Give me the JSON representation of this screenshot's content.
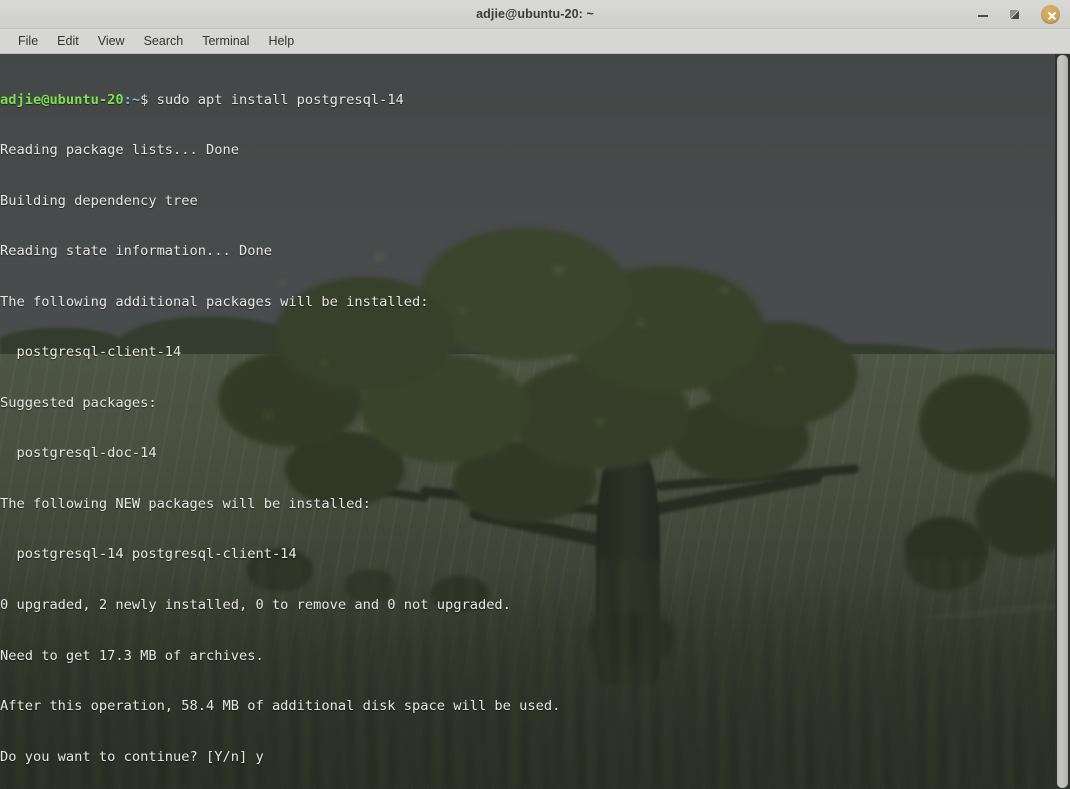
{
  "window": {
    "title": "adjie@ubuntu-20: ~",
    "controls": {
      "minimize_label": "minimize",
      "maximize_label": "restore",
      "close_label": "close",
      "close_color": "#c9a45c"
    }
  },
  "menubar": {
    "items": [
      {
        "label": "File"
      },
      {
        "label": "Edit"
      },
      {
        "label": "View"
      },
      {
        "label": "Search"
      },
      {
        "label": "Terminal"
      },
      {
        "label": "Help"
      }
    ]
  },
  "terminal": {
    "colors": {
      "prompt_user": "#7ee04f",
      "prompt_path": "#6ec5d8",
      "text": "#e8e8e3",
      "background": "#3b3e37"
    },
    "prompt": {
      "user_host": "adjie@ubuntu-20",
      "path": ":~",
      "symbol": "$",
      "command": " sudo apt install postgresql-14"
    },
    "output_lines": [
      "Reading package lists... Done",
      "Building dependency tree",
      "Reading state information... Done",
      "The following additional packages will be installed:",
      "  postgresql-client-14",
      "Suggested packages:",
      "  postgresql-doc-14",
      "The following NEW packages will be installed:",
      "  postgresql-14 postgresql-client-14",
      "0 upgraded, 2 newly installed, 0 to remove and 0 not upgraded.",
      "Need to get 17.3 MB of archives.",
      "After this operation, 58.4 MB of additional disk space will be used.",
      "Do you want to continue? [Y/n] y"
    ]
  },
  "scrollbar": {
    "label": "vertical-scrollbar"
  }
}
